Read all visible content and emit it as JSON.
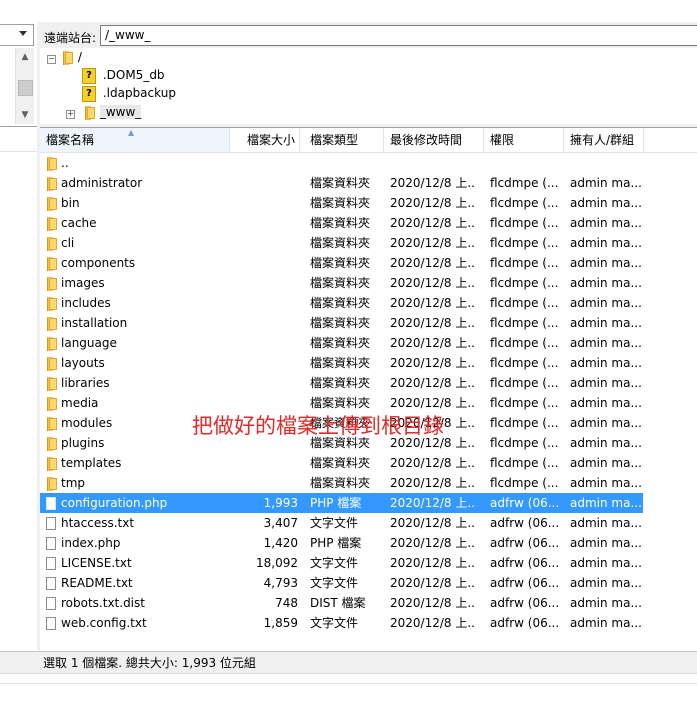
{
  "remote": {
    "label": "遠端站台:",
    "path": "/_www_"
  },
  "tree": {
    "root": "/",
    "items": [
      ".DOM5_db",
      ".ldapbackup",
      "_www_"
    ]
  },
  "columns": [
    "檔案名稱",
    "檔案大小",
    "檔案類型",
    "最後修改時間",
    "權限",
    "擁有人/群組"
  ],
  "rows": [
    {
      "name": "..",
      "size": "",
      "type": "",
      "date": "",
      "perm": "",
      "owner": "",
      "kind": "folder"
    },
    {
      "name": "administrator",
      "size": "",
      "type": "檔案資料夾",
      "date": "2020/12/8 上...",
      "perm": "flcdmpe (...",
      "owner": "admin ma...",
      "kind": "folder"
    },
    {
      "name": "bin",
      "size": "",
      "type": "檔案資料夾",
      "date": "2020/12/8 上...",
      "perm": "flcdmpe (...",
      "owner": "admin ma...",
      "kind": "folder"
    },
    {
      "name": "cache",
      "size": "",
      "type": "檔案資料夾",
      "date": "2020/12/8 上...",
      "perm": "flcdmpe (...",
      "owner": "admin ma...",
      "kind": "folder"
    },
    {
      "name": "cli",
      "size": "",
      "type": "檔案資料夾",
      "date": "2020/12/8 上...",
      "perm": "flcdmpe (...",
      "owner": "admin ma...",
      "kind": "folder"
    },
    {
      "name": "components",
      "size": "",
      "type": "檔案資料夾",
      "date": "2020/12/8 上...",
      "perm": "flcdmpe (...",
      "owner": "admin ma...",
      "kind": "folder"
    },
    {
      "name": "images",
      "size": "",
      "type": "檔案資料夾",
      "date": "2020/12/8 上...",
      "perm": "flcdmpe (...",
      "owner": "admin ma...",
      "kind": "folder"
    },
    {
      "name": "includes",
      "size": "",
      "type": "檔案資料夾",
      "date": "2020/12/8 上...",
      "perm": "flcdmpe (...",
      "owner": "admin ma...",
      "kind": "folder"
    },
    {
      "name": "installation",
      "size": "",
      "type": "檔案資料夾",
      "date": "2020/12/8 上...",
      "perm": "flcdmpe (...",
      "owner": "admin ma...",
      "kind": "folder"
    },
    {
      "name": "language",
      "size": "",
      "type": "檔案資料夾",
      "date": "2020/12/8 上...",
      "perm": "flcdmpe (...",
      "owner": "admin ma...",
      "kind": "folder"
    },
    {
      "name": "layouts",
      "size": "",
      "type": "檔案資料夾",
      "date": "2020/12/8 上...",
      "perm": "flcdmpe (...",
      "owner": "admin ma...",
      "kind": "folder"
    },
    {
      "name": "libraries",
      "size": "",
      "type": "檔案資料夾",
      "date": "2020/12/8 上...",
      "perm": "flcdmpe (...",
      "owner": "admin ma...",
      "kind": "folder"
    },
    {
      "name": "media",
      "size": "",
      "type": "檔案資料夾",
      "date": "2020/12/8 上...",
      "perm": "flcdmpe (...",
      "owner": "admin ma...",
      "kind": "folder"
    },
    {
      "name": "modules",
      "size": "",
      "type": "檔案資料夾",
      "date": "2020/12/8 上...",
      "perm": "flcdmpe (...",
      "owner": "admin ma...",
      "kind": "folder"
    },
    {
      "name": "plugins",
      "size": "",
      "type": "檔案資料夾",
      "date": "2020/12/8 上...",
      "perm": "flcdmpe (...",
      "owner": "admin ma...",
      "kind": "folder"
    },
    {
      "name": "templates",
      "size": "",
      "type": "檔案資料夾",
      "date": "2020/12/8 上...",
      "perm": "flcdmpe (...",
      "owner": "admin ma...",
      "kind": "folder"
    },
    {
      "name": "tmp",
      "size": "",
      "type": "檔案資料夾",
      "date": "2020/12/8 上...",
      "perm": "flcdmpe (...",
      "owner": "admin ma...",
      "kind": "folder"
    },
    {
      "name": "configuration.php",
      "size": "1,993",
      "type": "PHP 檔案",
      "date": "2020/12/8 上...",
      "perm": "adfrw (06...",
      "owner": "admin ma...",
      "kind": "file",
      "selected": true
    },
    {
      "name": "htaccess.txt",
      "size": "3,407",
      "type": "文字文件",
      "date": "2020/12/8 上...",
      "perm": "adfrw (06...",
      "owner": "admin ma...",
      "kind": "file"
    },
    {
      "name": "index.php",
      "size": "1,420",
      "type": "PHP 檔案",
      "date": "2020/12/8 上...",
      "perm": "adfrw (06...",
      "owner": "admin ma...",
      "kind": "file"
    },
    {
      "name": "LICENSE.txt",
      "size": "18,092",
      "type": "文字文件",
      "date": "2020/12/8 上...",
      "perm": "adfrw (06...",
      "owner": "admin ma...",
      "kind": "file"
    },
    {
      "name": "README.txt",
      "size": "4,793",
      "type": "文字文件",
      "date": "2020/12/8 上...",
      "perm": "adfrw (06...",
      "owner": "admin ma...",
      "kind": "file"
    },
    {
      "name": "robots.txt.dist",
      "size": "748",
      "type": "DIST 檔案",
      "date": "2020/12/8 上...",
      "perm": "adfrw (06...",
      "owner": "admin ma...",
      "kind": "file"
    },
    {
      "name": "web.config.txt",
      "size": "1,859",
      "type": "文字文件",
      "date": "2020/12/8 上...",
      "perm": "adfrw (06...",
      "owner": "admin ma...",
      "kind": "file"
    }
  ],
  "annotation": "把做好的檔案上傳到根目錄",
  "status": "選取 1 個檔案. 總共大小: 1,993 位元組",
  "colors": {
    "selection": "#3399ff",
    "annotation": "#e12a2a"
  }
}
